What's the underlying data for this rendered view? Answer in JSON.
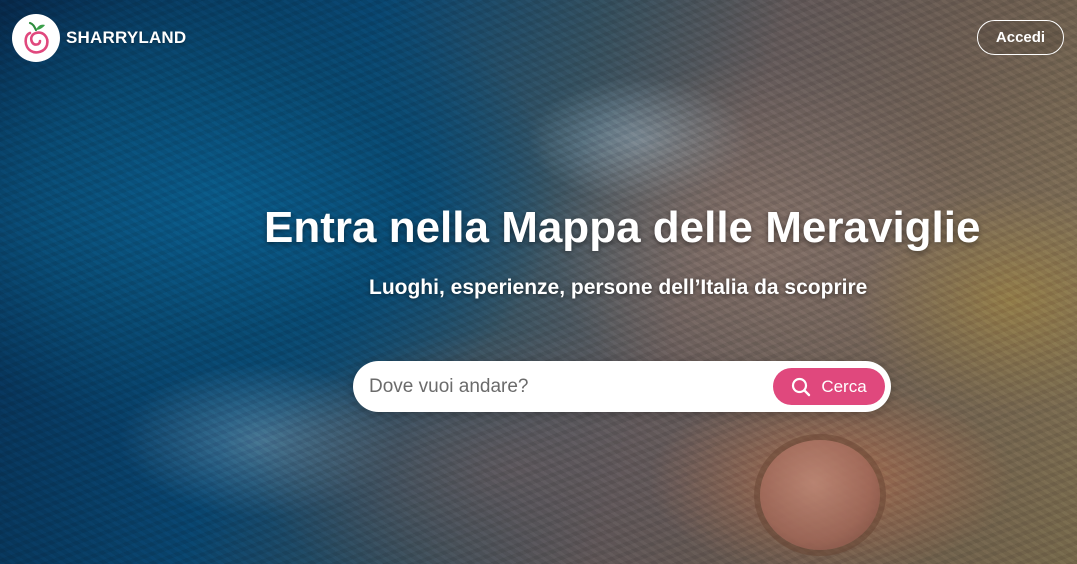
{
  "brand": {
    "name": "SHARRYLAND",
    "logo_icon": "sharryland-logo-icon"
  },
  "header": {
    "login_label": "Accedi"
  },
  "hero": {
    "title": "Entra nella Mappa delle Meraviglie",
    "subtitle": "Luoghi, esperienze, persone dell’Italia da scoprire",
    "background": "aerial-coastline-photo"
  },
  "search": {
    "placeholder": "Dove vuoi andare?",
    "value": "",
    "button_label": "Cerca",
    "button_icon": "search-icon"
  },
  "colors": {
    "accent": "#e0487d",
    "text_on_image": "#ffffff",
    "search_bg": "#ffffff"
  }
}
